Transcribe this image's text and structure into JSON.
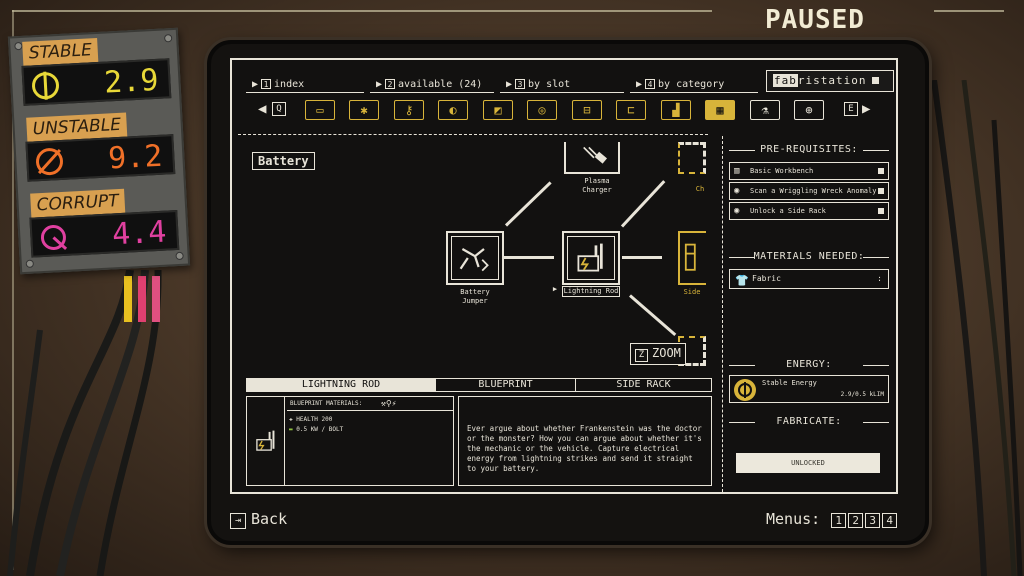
{
  "status": {
    "paused": "PAUSED"
  },
  "meters": [
    {
      "label": "STABLE",
      "value": "2.9",
      "color": "#e8d838",
      "icon": "stable-energy-icon"
    },
    {
      "label": "UNSTABLE",
      "value": "9.2",
      "color": "#f07028",
      "icon": "unstable-energy-icon"
    },
    {
      "label": "CORRUPT",
      "value": "4.4",
      "color": "#e040a0",
      "icon": "corrupt-energy-icon"
    }
  ],
  "tabs": [
    {
      "key": "1",
      "label": "index"
    },
    {
      "key": "2",
      "label": "available (24)"
    },
    {
      "key": "3",
      "label": "by slot"
    },
    {
      "key": "4",
      "label": "by category"
    }
  ],
  "brand": {
    "prefix": "fab",
    "suffix": "ristation"
  },
  "category_bar": {
    "prev_key": "Q",
    "next_key": "E",
    "items": [
      "engine-icon",
      "gear-icon",
      "key-icon",
      "headlight-icon",
      "door-icon",
      "wheel-icon",
      "car-icon",
      "car-side-icon",
      "seat-icon",
      "battery-icon",
      "tool-bag-icon",
      "paint-icon"
    ],
    "active_index": 9
  },
  "tree": {
    "title": "Battery",
    "nodes": [
      {
        "id": "plasma",
        "label": "Plasma Charger"
      },
      {
        "id": "jumper",
        "label": "Battery Jumper"
      },
      {
        "id": "rod",
        "label": "Lightning Rod"
      },
      {
        "id": "side",
        "label": "Side"
      },
      {
        "id": "right-top",
        "label": "Ch"
      }
    ],
    "zoom": {
      "key": "Z",
      "label": "ZOOM"
    }
  },
  "right_panel": {
    "prereq_heading": "PRE-REQUISITES:",
    "prereqs": [
      {
        "icon": "workbench-icon",
        "text": "Basic Workbench"
      },
      {
        "icon": "eye-icon",
        "text": "Scan a Wriggling Wreck Anomaly"
      },
      {
        "icon": "eye-icon",
        "text": "Unlock a Side Rack"
      }
    ],
    "materials_heading": "MATERIALS NEEDED:",
    "materials": [
      {
        "icon": "shirt-icon",
        "name": "Fabric",
        "qty": ":"
      }
    ],
    "energy_heading": "ENERGY:",
    "energy": {
      "name": "Stable Energy",
      "amount": "2.9/0.5 kLIM",
      "color": "#d8b43a"
    },
    "fabricate_heading": "FABRICATE:",
    "fabricate_button": "UNLOCKED"
  },
  "bottom_tabs": [
    "LIGHTNING ROD",
    "BLUEPRINT",
    "SIDE RACK"
  ],
  "blueprint": {
    "header": "BLUEPRINT MATERIALS:",
    "stats": [
      {
        "icon": "health-icon",
        "text": "HEALTH  200"
      },
      {
        "icon": "battery-icon",
        "text": "0.5 KW / BOLT"
      }
    ]
  },
  "description": "Ever argue about whether Frankenstein was the doctor or the monster? How you can argue about whether it's the mechanic or the vehicle. Capture electrical energy from lightning strikes and send it straight to your battery.",
  "footer": {
    "back_label": "Back",
    "menus_label": "Menus:",
    "menu_numbers": [
      "1",
      "2",
      "3",
      "4"
    ]
  }
}
